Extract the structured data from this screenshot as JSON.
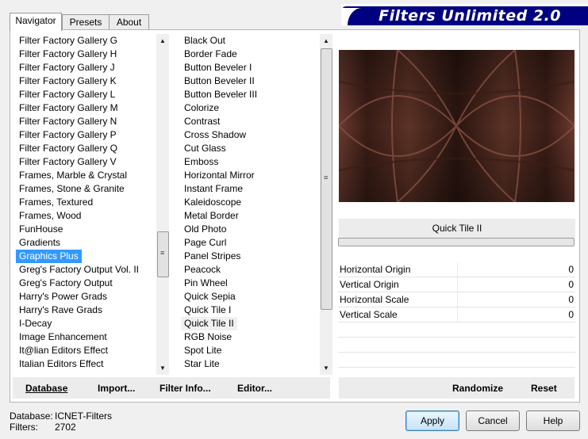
{
  "tabs": [
    {
      "label": "Navigator",
      "active": true
    },
    {
      "label": "Presets",
      "active": false
    },
    {
      "label": "About",
      "active": false
    }
  ],
  "banner": {
    "title": "Filters Unlimited 2.0"
  },
  "categories": {
    "items": [
      "Filter Factory Gallery G",
      "Filter Factory Gallery H",
      "Filter Factory Gallery J",
      "Filter Factory Gallery K",
      "Filter Factory Gallery L",
      "Filter Factory Gallery M",
      "Filter Factory Gallery N",
      "Filter Factory Gallery P",
      "Filter Factory Gallery Q",
      "Filter Factory Gallery V",
      "Frames, Marble & Crystal",
      "Frames, Stone & Granite",
      "Frames, Textured",
      "Frames, Wood",
      "FunHouse",
      "Gradients",
      "Graphics Plus",
      "Greg's Factory Output Vol. II",
      "Greg's Factory Output",
      "Harry's Power Grads",
      "Harry's Rave Grads",
      "I-Decay",
      "Image Enhancement",
      "It@lian Editors Effect",
      "Italian Editors Effect"
    ],
    "selected": "Graphics Plus"
  },
  "filters": {
    "items": [
      "Black Out",
      "Border Fade",
      "Button Beveler I",
      "Button Beveler II",
      "Button Beveler III",
      "Colorize",
      "Contrast",
      "Cross Shadow",
      "Cut Glass",
      "Emboss",
      "Horizontal Mirror",
      "Instant Frame",
      "Kaleidoscope",
      "Metal Border",
      "Old Photo",
      "Page Curl",
      "Panel Stripes",
      "Peacock",
      "Pin Wheel",
      "Quick Sepia",
      "Quick Tile I",
      "Quick Tile II",
      "RGB Noise",
      "Spot Lite",
      "Star Lite"
    ],
    "selected": "Quick Tile II"
  },
  "bottom_left": {
    "database": "Database",
    "import": "Import...",
    "filter_info": "Filter Info...",
    "editor": "Editor..."
  },
  "filter_name": "Quick Tile II",
  "params": [
    {
      "label": "Horizontal Origin",
      "value": "0"
    },
    {
      "label": "Vertical Origin",
      "value": "0"
    },
    {
      "label": "Horizontal Scale",
      "value": "0"
    },
    {
      "label": "Vertical Scale",
      "value": "0"
    }
  ],
  "right_bar": {
    "randomize": "Randomize",
    "reset": "Reset"
  },
  "footer": {
    "database_label": "Database:",
    "database_value": "ICNET-Filters",
    "filters_label": "Filters:",
    "filters_value": "2702"
  },
  "buttons": {
    "apply": "Apply",
    "cancel": "Cancel",
    "help": "Help"
  },
  "colors": {
    "selection": "#3399ff",
    "banner": "#000080",
    "preview_dark": "#2a1510",
    "preview_light": "#7a4638"
  }
}
